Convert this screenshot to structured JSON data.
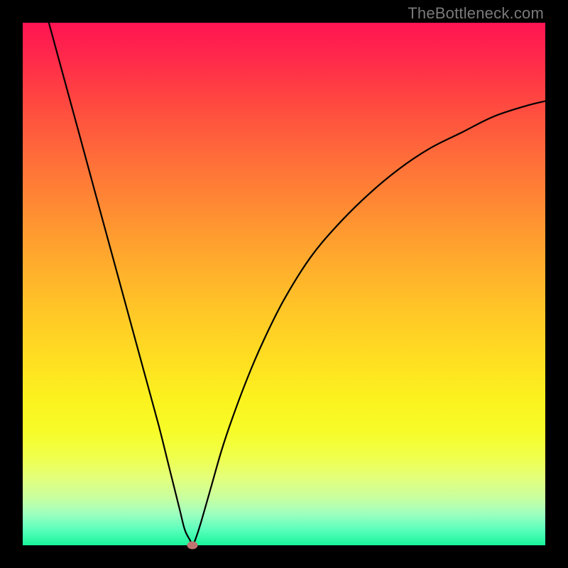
{
  "watermark": "TheBottleneck.com",
  "chart_data": {
    "type": "line",
    "title": "",
    "xlabel": "",
    "ylabel": "",
    "xlim": [
      0,
      100
    ],
    "ylim": [
      0,
      100
    ],
    "series": [
      {
        "name": "curve",
        "x": [
          5,
          8,
          11,
          14,
          17,
          20,
          23,
          26,
          28,
          30,
          31,
          32,
          32.5,
          33,
          34,
          36,
          38,
          40,
          43,
          46,
          50,
          55,
          60,
          66,
          72,
          78,
          84,
          90,
          96,
          100
        ],
        "y": [
          100,
          89,
          78,
          67,
          56,
          45,
          34,
          23,
          15,
          7,
          3,
          1,
          0,
          1,
          4,
          11,
          18,
          24,
          32,
          39,
          47,
          55,
          61,
          67,
          72,
          76,
          79,
          82,
          84,
          85
        ]
      }
    ],
    "marker": {
      "x": 32.5,
      "y": 0
    }
  },
  "colors": {
    "curve": "#000000",
    "marker": "#c07470",
    "frame": "#000000"
  }
}
